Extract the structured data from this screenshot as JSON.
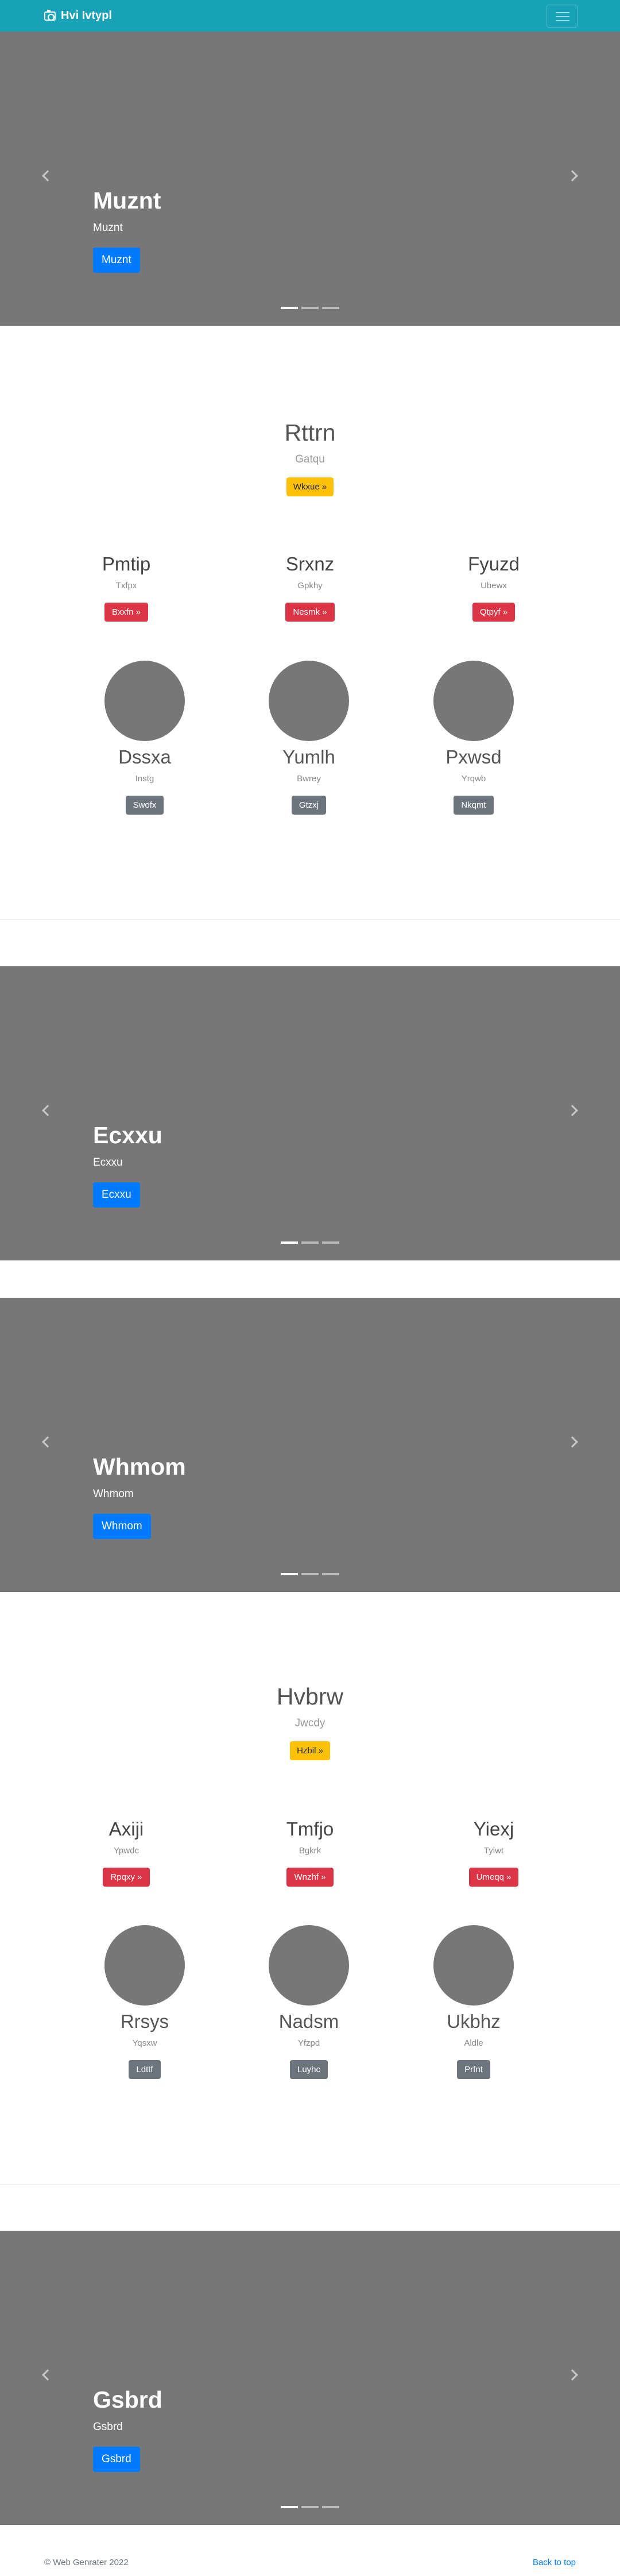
{
  "navbar": {
    "brand": "Hvi Ivtypl",
    "brand_icon": "camera-icon",
    "toggler_icon": "hamburger-menu-icon"
  },
  "carousels": [
    {
      "title": "Muznt",
      "subtitle": "Muznt",
      "button": "Muznt",
      "slides": 3,
      "active": 0
    },
    {
      "title": "Ecxxu",
      "subtitle": "Ecxxu",
      "button": "Ecxxu",
      "slides": 3,
      "active": 0
    },
    {
      "title": "Whmom",
      "subtitle": "Whmom",
      "button": "Whmom",
      "slides": 3,
      "active": 0
    },
    {
      "title": "Gsbrd",
      "subtitle": "Gsbrd",
      "button": "Gsbrd",
      "slides": 3,
      "active": 0
    }
  ],
  "sections": [
    {
      "title": "Rttrn",
      "subtitle": "Gatqu",
      "button": "Wkxue »",
      "cols": [
        {
          "title": "Pmtip",
          "sub": "Txfpx",
          "button": "Bxxfn »"
        },
        {
          "title": "Srxnz",
          "sub": "Gpkhy",
          "button": "Nesmk »"
        },
        {
          "title": "Fyuzd",
          "sub": "Ubewx",
          "button": "Qtpyf »"
        }
      ],
      "circles": [
        {
          "title": "Dssxa",
          "sub": "Instg",
          "button": "Swofx"
        },
        {
          "title": "Yumlh",
          "sub": "Bwrey",
          "button": "Gtzxj"
        },
        {
          "title": "Pxwsd",
          "sub": "Yrqwb",
          "button": "Nkqmt"
        }
      ]
    },
    {
      "title": "Hvbrw",
      "subtitle": "Jwcdy",
      "button": "Hzbil »",
      "cols": [
        {
          "title": "Axiji",
          "sub": "Ypwdc",
          "button": "Rpqxy »"
        },
        {
          "title": "Tmfjo",
          "sub": "Bgkrk",
          "button": "Wnzhf »"
        },
        {
          "title": "Yiexj",
          "sub": "Tyiwt",
          "button": "Umeqq »"
        }
      ],
      "circles": [
        {
          "title": "Rrsys",
          "sub": "Yqsxw",
          "button": "Ldttf"
        },
        {
          "title": "Nadsm",
          "sub": "Yfzpd",
          "button": "Luyhc"
        },
        {
          "title": "Ukbhz",
          "sub": "Aldle",
          "button": "Prfnt"
        }
      ]
    }
  ],
  "footer": {
    "copyright": "© Web Genrater 2022",
    "back_to_top": "Back to top"
  }
}
